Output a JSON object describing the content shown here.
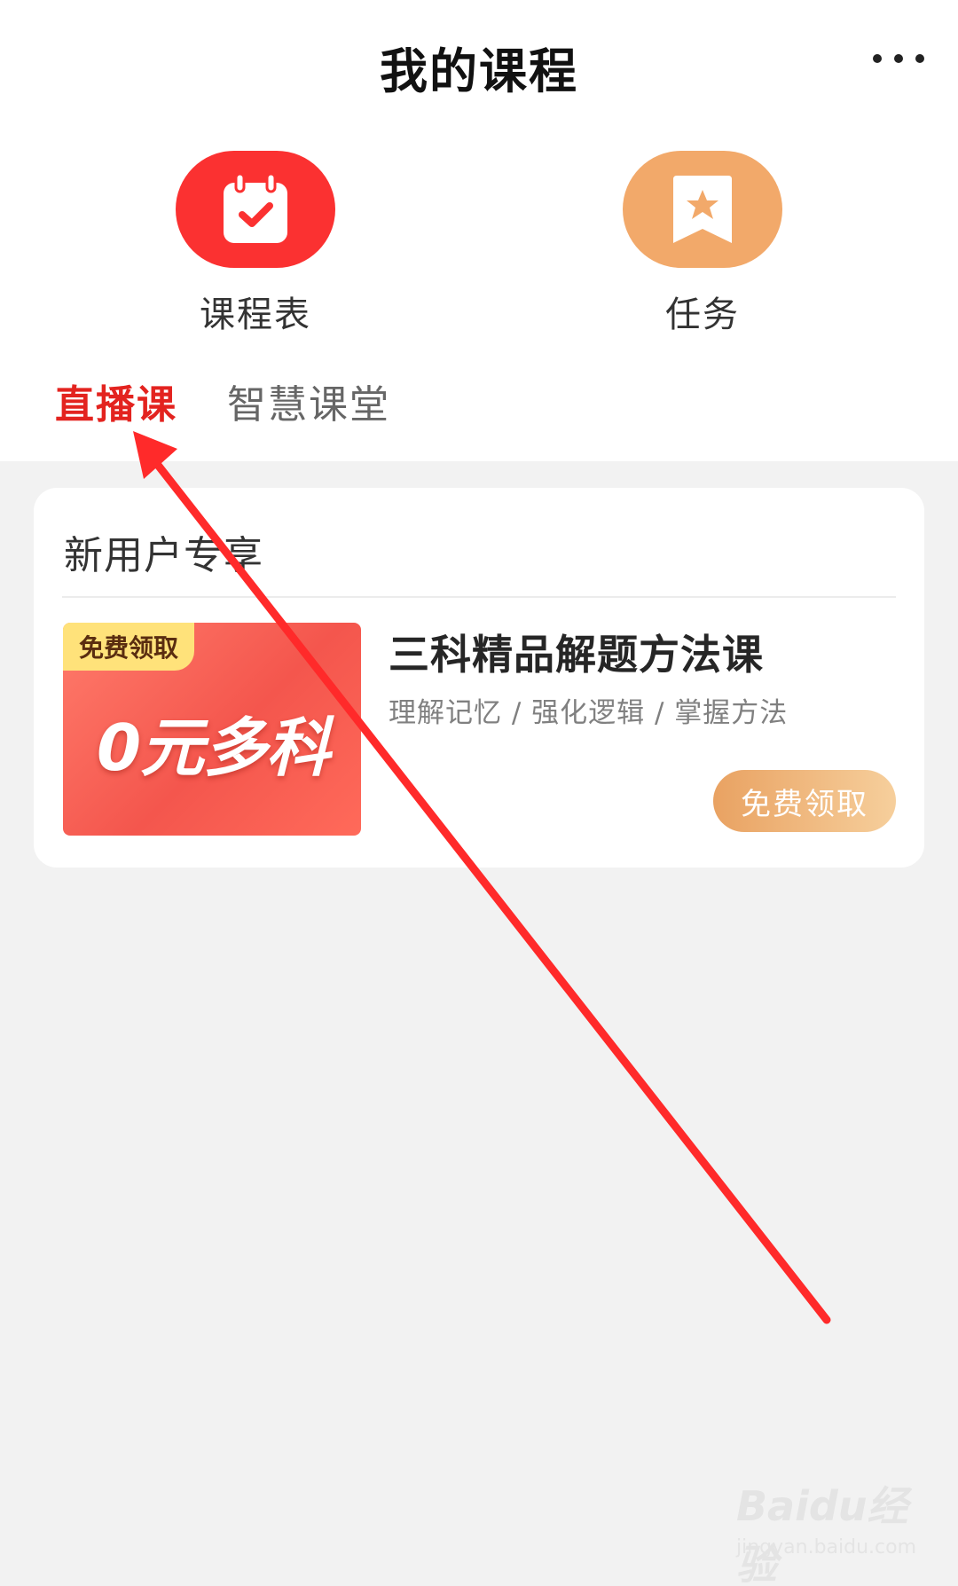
{
  "header": {
    "title": "我的课程",
    "more_icon": "more-horizontal-icon"
  },
  "shortcuts": [
    {
      "label": "课程表",
      "icon": "calendar-check-icon",
      "color": "#fb3131"
    },
    {
      "label": "任务",
      "icon": "bookmark-star-icon",
      "color": "#f2a96a"
    }
  ],
  "tabs": [
    {
      "label": "直播课",
      "active": true
    },
    {
      "label": "智慧课堂",
      "active": false
    }
  ],
  "colors": {
    "accent_red": "#e3231f",
    "claim_button_start": "#e9a262",
    "claim_button_end": "#f6cf9c",
    "background": "#f2f2f2"
  },
  "card": {
    "title": "新用户专享",
    "promo": {
      "tag": "免费领取",
      "headline": "0元多科"
    },
    "course": {
      "title": "三科精品解题方法课",
      "subtitle": "理解记忆 / 强化逻辑 / 掌握方法",
      "button_label": "免费领取"
    }
  },
  "watermark": {
    "brand": "Baidu经验",
    "url": "jingyan.baidu.com"
  }
}
